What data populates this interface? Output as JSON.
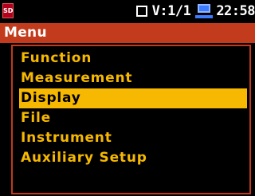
{
  "status": {
    "sd_label": "SD",
    "view_indicator": "V:1/1",
    "time": "22:58"
  },
  "menu": {
    "title": "Menu",
    "items": [
      {
        "label": "Function"
      },
      {
        "label": "Measurement"
      },
      {
        "label": "Display",
        "selected": true
      },
      {
        "label": "File"
      },
      {
        "label": "Instrument"
      },
      {
        "label": "Auxiliary Setup"
      }
    ]
  },
  "colors": {
    "accent": "#c23b1c",
    "menu_text": "#f6b800",
    "selection": "#f6b800",
    "battery": "#3a7bff",
    "background": "#000000"
  }
}
